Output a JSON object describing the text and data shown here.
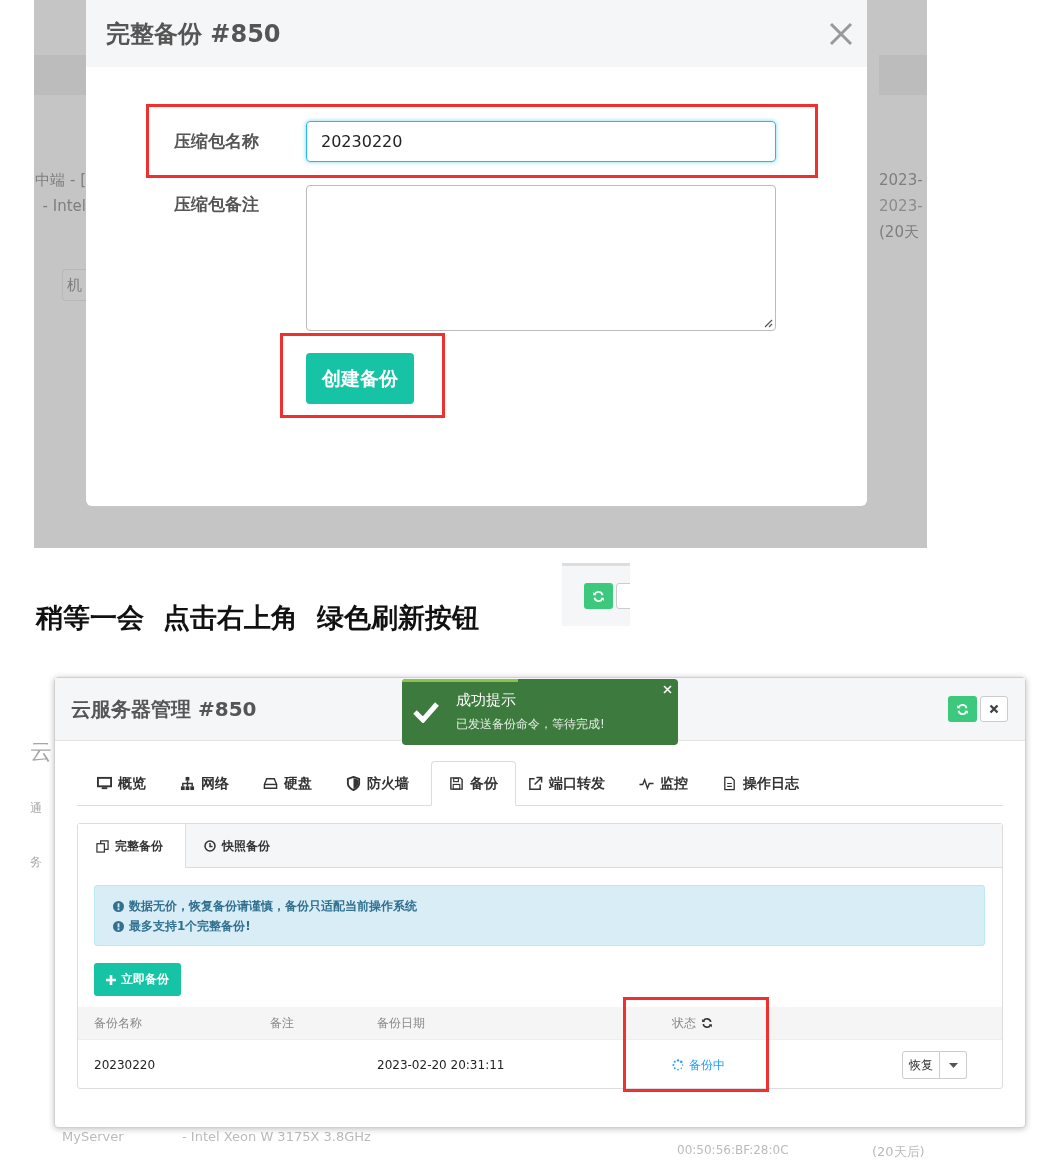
{
  "backup_dialog_screenshot": {
    "backdrop_left": [
      "中端 - [",
      "- Intel",
      "机"
    ],
    "backdrop_right": [
      "2023-",
      "2023-",
      "(20天"
    ],
    "dialog": {
      "title": "完整备份 #850",
      "fields": [
        {
          "kind": "input",
          "label": "压缩包名称",
          "value": "20230220",
          "focused": true
        },
        {
          "kind": "textarea",
          "label": "压缩包备注",
          "focused": false
        }
      ],
      "submit_button": "创建备份"
    }
  },
  "instruction": "稍等一会  点击右上角  绿色刷新按钮",
  "server_panel_screenshot": {
    "backdrop_left": [
      "云",
      "通",
      "务"
    ],
    "backdrop_bottom": [
      "MyServer",
      "- Intel Xeon W 3175X 3.8GHz",
      "00:50:56:BF:28:0C",
      "(20天后)"
    ],
    "title": "云服务器管理 #850",
    "toast": {
      "title": "成功提示",
      "message": "已发送备份命令，等待完成!",
      "level": 0.42
    },
    "tabs": [
      {
        "label": "概览",
        "selected": false
      },
      {
        "label": "网络",
        "selected": false
      },
      {
        "label": "硬盘",
        "selected": false
      },
      {
        "label": "防火墙",
        "selected": false
      },
      {
        "label": "备份",
        "selected": true
      },
      {
        "label": "端口转发",
        "selected": false
      },
      {
        "label": "监控",
        "selected": false
      },
      {
        "label": "操作日志",
        "selected": false
      }
    ],
    "subtabs": [
      {
        "label": "完整备份",
        "selected": true
      },
      {
        "label": "快照备份",
        "selected": false
      }
    ],
    "notices": [
      "数据无价，恢复备份请谨慎，备份只适配当前操作系统",
      "最多支持1个完整备份!"
    ],
    "backup_now_button": "立即备份",
    "table": {
      "columns": [
        "备份名称",
        "备注",
        "备份日期",
        "状态"
      ],
      "rows": [
        {
          "name": "20230220",
          "note": "",
          "date": "2023-02-20 20:31:11",
          "status": "备份中",
          "in_progress": true,
          "action": "恢复"
        }
      ]
    }
  }
}
